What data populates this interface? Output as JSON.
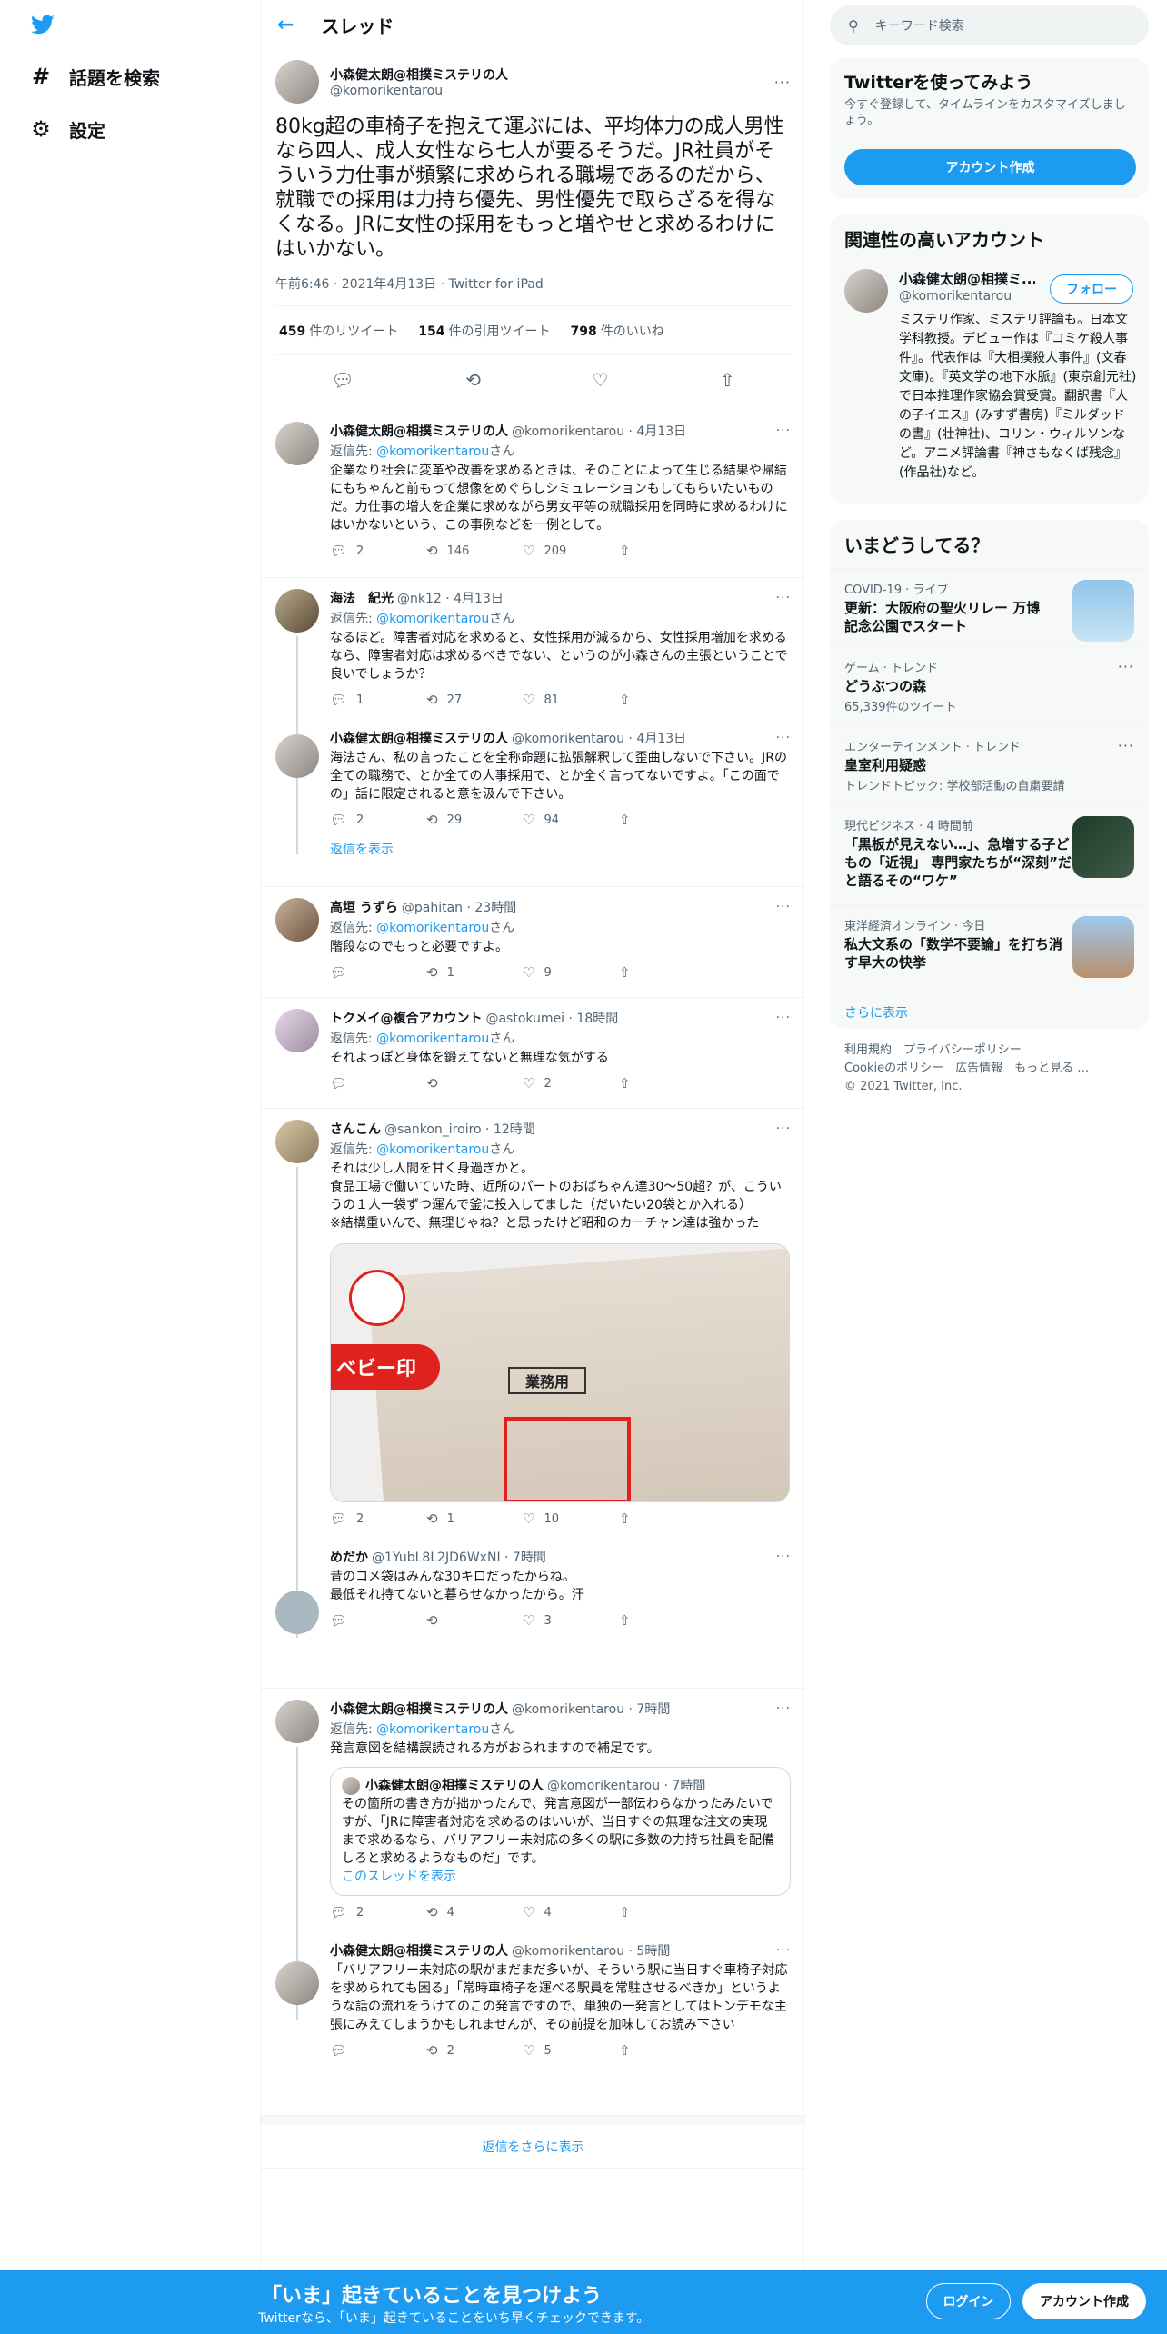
{
  "nav": {
    "explore": "話題を検索",
    "settings": "設定"
  },
  "header": {
    "title": "スレッド"
  },
  "main_tweet": {
    "name": "小森健太朗@相撲ミステリの人",
    "handle": "@komorikentarou",
    "text": "80kg超の車椅子を抱えて運ぶには、平均体力の成人男性なら四人、成人女性なら七人が要るそうだ。JR社員がそういう力仕事が頻繁に求められる職場であるのだから、就職での採用は力持ち優先、男性優先で取らざるを得なくなる。JRに女性の採用をもっと増やせと求めるわけにはいかない。",
    "meta": "午前6:46 · 2021年4月13日 · Twitter for iPad",
    "retweets": "459",
    "retweets_label": "件のリツイート",
    "quotes": "154",
    "quotes_label": "件の引用ツイート",
    "likes": "798",
    "likes_label": "件のいいね"
  },
  "replies": [
    {
      "name": "小森健太朗@相撲ミステリの人",
      "handle": "@komorikentarou · 4月13日",
      "reply_to_prefix": "返信先: ",
      "reply_to": "@komorikentarou",
      "reply_to_suffix": "さん",
      "text": "企業なり社会に変革や改善を求めるときは、そのことによって生じる結果や帰結にもちゃんと前もって想像をめぐらしシミュレーションもしてもらいたいものだ。力仕事の増大を企業に求めながら男女平等の就職採用を同時に求めるわけにはいかないという、この事例などを一例として。",
      "replies": "2",
      "retweets": "146",
      "likes": "209"
    },
    {
      "name": "海法　紀光",
      "handle": "@nk12 · 4月13日",
      "reply_to_prefix": "返信先: ",
      "reply_to": "@komorikentarou",
      "reply_to_suffix": "さん",
      "text": "なるほど。障害者対応を求めると、女性採用が減るから、女性採用増加を求めるなら、障害者対応は求めるべきでない、というのが小森さんの主張ということで良いでしょうか？",
      "replies": "1",
      "retweets": "27",
      "likes": "81"
    },
    {
      "name": "小森健太朗@相撲ミステリの人",
      "handle": "@komorikentarou · 4月13日",
      "text": "海法さん、私の言ったことを全称命題に拡張解釈して歪曲しないで下さい。JRの全ての職務で、とか全ての人事採用で、とか全く言ってないですよ。「この面での」話に限定されると意を汲んで下さい。",
      "replies": "2",
      "retweets": "29",
      "likes": "94",
      "show_replies": "返信を表示"
    },
    {
      "name": "高垣 うずら",
      "handle": "@pahitan · 23時間",
      "reply_to_prefix": "返信先: ",
      "reply_to": "@komorikentarou",
      "reply_to_suffix": "さん",
      "text": "階段なのでもっと必要ですよ。",
      "replies": "",
      "retweets": "1",
      "likes": "9"
    },
    {
      "name": "トクメイ@複合アカウント",
      "handle": "@astokumei · 18時間",
      "reply_to_prefix": "返信先: ",
      "reply_to": "@komorikentarou",
      "reply_to_suffix": "さん",
      "text": "それよっぽど身体を鍛えてないと無理な気がする",
      "replies": "",
      "retweets": "",
      "likes": "2"
    },
    {
      "name": "さんこん",
      "handle": "@sankon_iroiro · 12時間",
      "reply_to_prefix": "返信先: ",
      "reply_to": "@komorikentarou",
      "reply_to_suffix": "さん",
      "text": "それは少し人間を甘く身過ぎかと。\n食品工場で働いていた時、近所のパートのおばちゃん達30〜50超？が、こういうの１人一袋ずつ運んで釜に投入してました（だいたい20袋とか入れる）\n※結構重いんで、無理じゃね？と思ったけど昭和のカーチャン達は強かった",
      "replies": "2",
      "retweets": "1",
      "likes": "10",
      "image_label_1": "ベビー印",
      "image_label_2": "業務用"
    },
    {
      "name": "めだか",
      "handle": "@1YubL8L2JD6WxNI · 7時間",
      "text": "昔のコメ袋はみんな30キロだったからね。\n最低それ持てないと暮らせなかったから。汗",
      "replies": "",
      "retweets": "",
      "likes": "3"
    },
    {
      "name": "小森健太朗@相撲ミステリの人",
      "handle": "@komorikentarou · 7時間",
      "reply_to_prefix": "返信先: ",
      "reply_to": "@komorikentarou",
      "reply_to_suffix": "さん",
      "text": "発言意図を結構誤読される方がおられますので補足です。",
      "replies": "2",
      "retweets": "4",
      "likes": "4",
      "quote": {
        "name": "小森健太朗@相撲ミステリの人",
        "handle": "@komorikentarou · 7時間",
        "text": "その箇所の書き方が拙かったんで、発言意図が一部伝わらなかったみたいですが、「JRに障害者対応を求めるのはいいが、当日すぐの無理な注文の実現まで求めるなら、バリアフリー未対応の多くの駅に多数の力持ち社員を配備しろと求めるようなものだ」です。",
        "link": "このスレッドを表示"
      }
    },
    {
      "name": "小森健太朗@相撲ミステリの人",
      "handle": "@komorikentarou · 5時間",
      "text": "「バリアフリー未対応の駅がまだまだ多いが、そういう駅に当日すぐ車椅子対応を求められても困る」「常時車椅子を運べる駅員を常駐させるべきか」というような話の流れをうけてのこの発言ですので、単独の一発言としてはトンデモな主張にみえてしまうかもしれませんが、その前提を加味してお読み下さい",
      "replies": "",
      "retweets": "2",
      "likes": "5"
    }
  ],
  "show_more_replies": "返信をさらに表示",
  "search": {
    "placeholder": "キーワード検索"
  },
  "signup_box": {
    "title": "Twitterを使ってみよう",
    "desc": "今すぐ登録して、タイムラインをカスタマイズしましょう。",
    "button": "アカウント作成"
  },
  "related": {
    "title": "関連性の高いアカウント",
    "name": "小森健太朗@相撲ミ...",
    "handle": "@komorikentarou",
    "follow": "フォロー",
    "bio": "ミステリ作家、ミステリ評論も。日本文学科教授。デビュー作は『コミケ殺人事件』。代表作は『大相撲殺人事件』(文春文庫)。『英文学の地下水脈』(東京創元社)で日本推理作家協会賞受賞。翻訳書『人の子イエス』(みすず書房)『ミルダッドの書』(壮神社)、コリン・ウィルソンなど。アニメ評論書『神さもなくば残念』(作品社)など。"
  },
  "trends": {
    "title": "いまどうしてる？",
    "items": [
      {
        "category": "COVID-19 · ライブ",
        "title": "更新：大阪府の聖火リレー 万博記念公園でスタート",
        "sub": ""
      },
      {
        "category": "ゲーム · トレンド",
        "title": "どうぶつの森",
        "sub": "65,339件のツイート"
      },
      {
        "category": "エンターテインメント · トレンド",
        "title": "皇室利用疑惑",
        "sub": "トレンドトピック: 学校部活動の自粛要請"
      },
      {
        "category": "現代ビジネス · 4 時間前",
        "title": "「黒板が見えない…」、急増する子どもの「近視」 専門家たちが“深刻”だと語るその“ワケ”",
        "sub": ""
      },
      {
        "category": "東洋経済オンライン · 今日",
        "title": "私大文系の「数学不要論」を打ち消す早大の快挙",
        "sub": ""
      }
    ],
    "more": "さらに表示"
  },
  "footer": {
    "line1": "利用規約　プライバシーポリシー",
    "line2": "Cookieのポリシー　広告情報　もっと見る …",
    "line3": "© 2021 Twitter, Inc."
  },
  "bottom_bar": {
    "title": "「いま」起きていることを見つけよう",
    "sub": "Twitterなら、「いま」起きていることをいち早くチェックできます。",
    "login": "ログイン",
    "signup": "アカウント作成"
  },
  "colors": {
    "accent": "#1d9bf0",
    "text": "#0f1419",
    "muted": "#536471"
  }
}
